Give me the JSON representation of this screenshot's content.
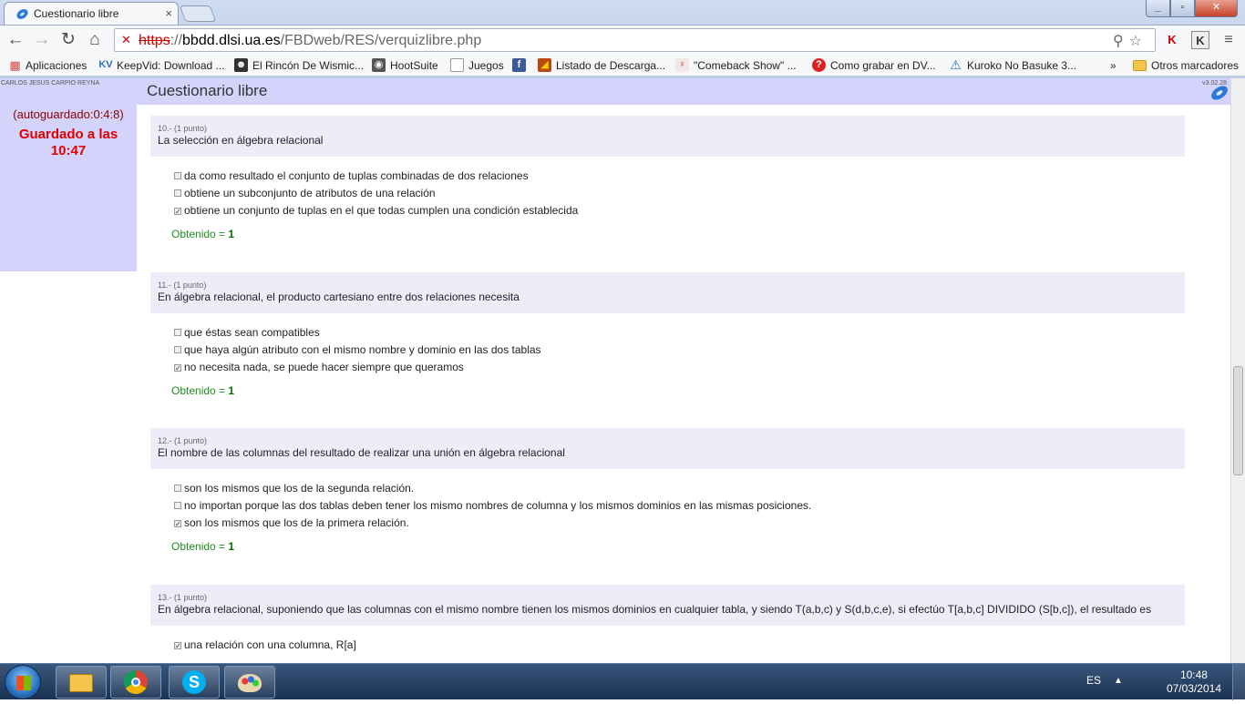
{
  "browser": {
    "tab_title": "Cuestionario libre",
    "tab_close": "×",
    "url_proto": "https",
    "url_sep": "://",
    "url_host": "bbdd.dlsi.ua.es",
    "url_path": "/FBDweb/RES/verquizlibre.php"
  },
  "bookmarks": {
    "items": [
      {
        "label": "Aplicaciones"
      },
      {
        "label": "KeepVid: Download ..."
      },
      {
        "label": "El Rincón De Wismic..."
      },
      {
        "label": "HootSuite"
      },
      {
        "label": "Juegos"
      },
      {
        "label": "Listado de Descarga..."
      },
      {
        "label": "\"Comeback Show\" ..."
      },
      {
        "label": "Como grabar en DV..."
      },
      {
        "label": "Kuroko No Basuke 3..."
      }
    ],
    "more": "»",
    "other": "Otros marcadores"
  },
  "page": {
    "user": "CARLOS JESUS CARPIO REYNA",
    "title": "Cuestionario libre",
    "version": "v3.02.28",
    "autosave": "(autoguardado:0:4:8)",
    "saved": "Guardado a las 10:47"
  },
  "result_label": "Obtenido =",
  "questions": [
    {
      "num": "10.- (1 punto)",
      "text": "La selección en álgebra relacional",
      "options": [
        {
          "text": "da como resultado el conjunto de tuplas combinadas de dos relaciones",
          "checked": false
        },
        {
          "text": "obtiene un subconjunto de atributos de una relación",
          "checked": false
        },
        {
          "text": "obtiene un conjunto de tuplas en el que todas cumplen una condición establecida",
          "checked": true
        }
      ],
      "score": "1"
    },
    {
      "num": "11.- (1 punto)",
      "text": "En álgebra relacional, el producto cartesiano entre dos relaciones necesita",
      "options": [
        {
          "text": "que éstas sean compatibles",
          "checked": false
        },
        {
          "text": "que haya algún atributo con el mismo nombre y dominio en las dos tablas",
          "checked": false
        },
        {
          "text": "no necesita nada, se puede hacer siempre que queramos",
          "checked": true
        }
      ],
      "score": "1"
    },
    {
      "num": "12.- (1 punto)",
      "text": "El nombre de las columnas del resultado de realizar una unión en álgebra relacional",
      "options": [
        {
          "text": "son los mismos que los de la segunda relación.",
          "checked": false
        },
        {
          "text": "no importan porque las dos tablas deben tener los mismo nombres de columna y los mismos dominios en las mismas posiciones.",
          "checked": false
        },
        {
          "text": "son los mismos que los de la primera relación.",
          "checked": true
        }
      ],
      "score": "1"
    },
    {
      "num": "13.- (1 punto)",
      "text": "En álgebra relacional, suponiendo que las columnas con el mismo nombre tienen los mismos dominios en cualquier tabla, y siendo T(a,b,c) y S(d,b,c,e), si efectúo T[a,b,c] DIVIDIDO (S[b,c]), el resultado es",
      "options": [
        {
          "text": "una relación con una columna, R[a]",
          "checked": true
        }
      ],
      "score": ""
    }
  ],
  "taskbar": {
    "lang": "ES",
    "time": "10:48",
    "date": "07/03/2014"
  },
  "colors": {
    "header_bg": "#d3d3fb",
    "question_bg": "#ededfa",
    "saved_red": "#e00000",
    "result_green": "#228b22"
  }
}
